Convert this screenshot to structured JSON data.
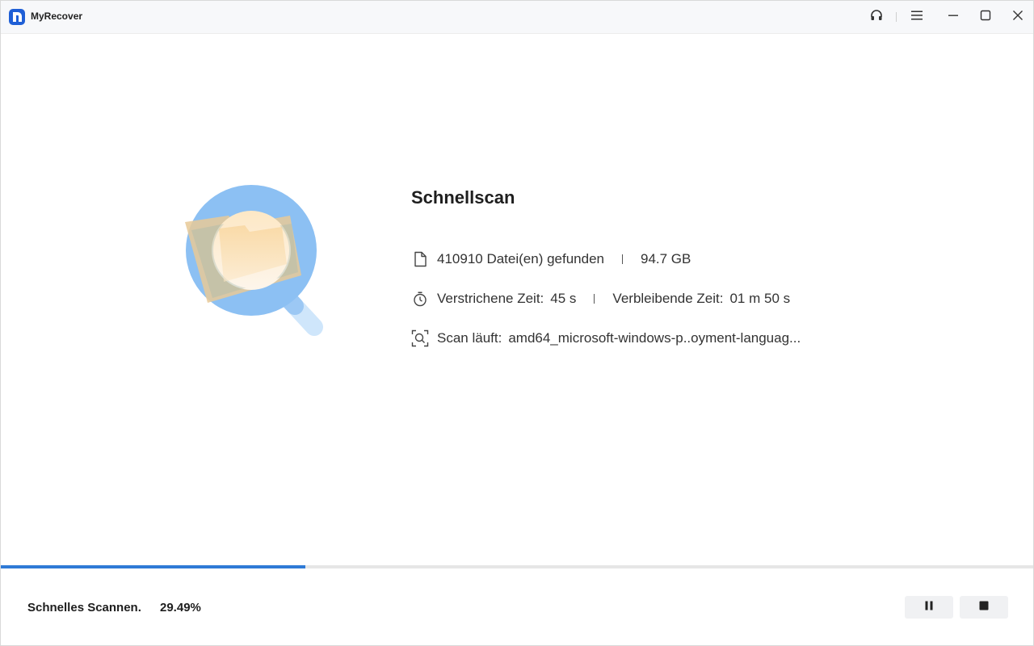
{
  "window": {
    "app_title": "MyRecover",
    "controls": {
      "support": "headset-icon",
      "menu": "menu-icon",
      "minimize": "minimize-icon",
      "maximize": "maximize-icon",
      "close": "close-icon"
    }
  },
  "scan": {
    "title": "Schnellscan",
    "files_found": "410910 Datei(en) gefunden",
    "size": "94.7 GB",
    "elapsed_label": "Verstrichene Zeit:",
    "elapsed_value": "45 s",
    "remaining_label": "Verbleibende Zeit:",
    "remaining_value": "01 m 50 s",
    "current_label": "Scan läuft:",
    "current_value": "amd64_microsoft-windows-p..oyment-languag..."
  },
  "status": {
    "label": "Schnelles Scannen.",
    "percent_text": "29.49%",
    "progress": 0.2949
  },
  "colors": {
    "accent": "#2f7ad6",
    "brand": "#1f5fd6",
    "track": "#e6e6e6",
    "button_bg": "#f0f1f3"
  }
}
